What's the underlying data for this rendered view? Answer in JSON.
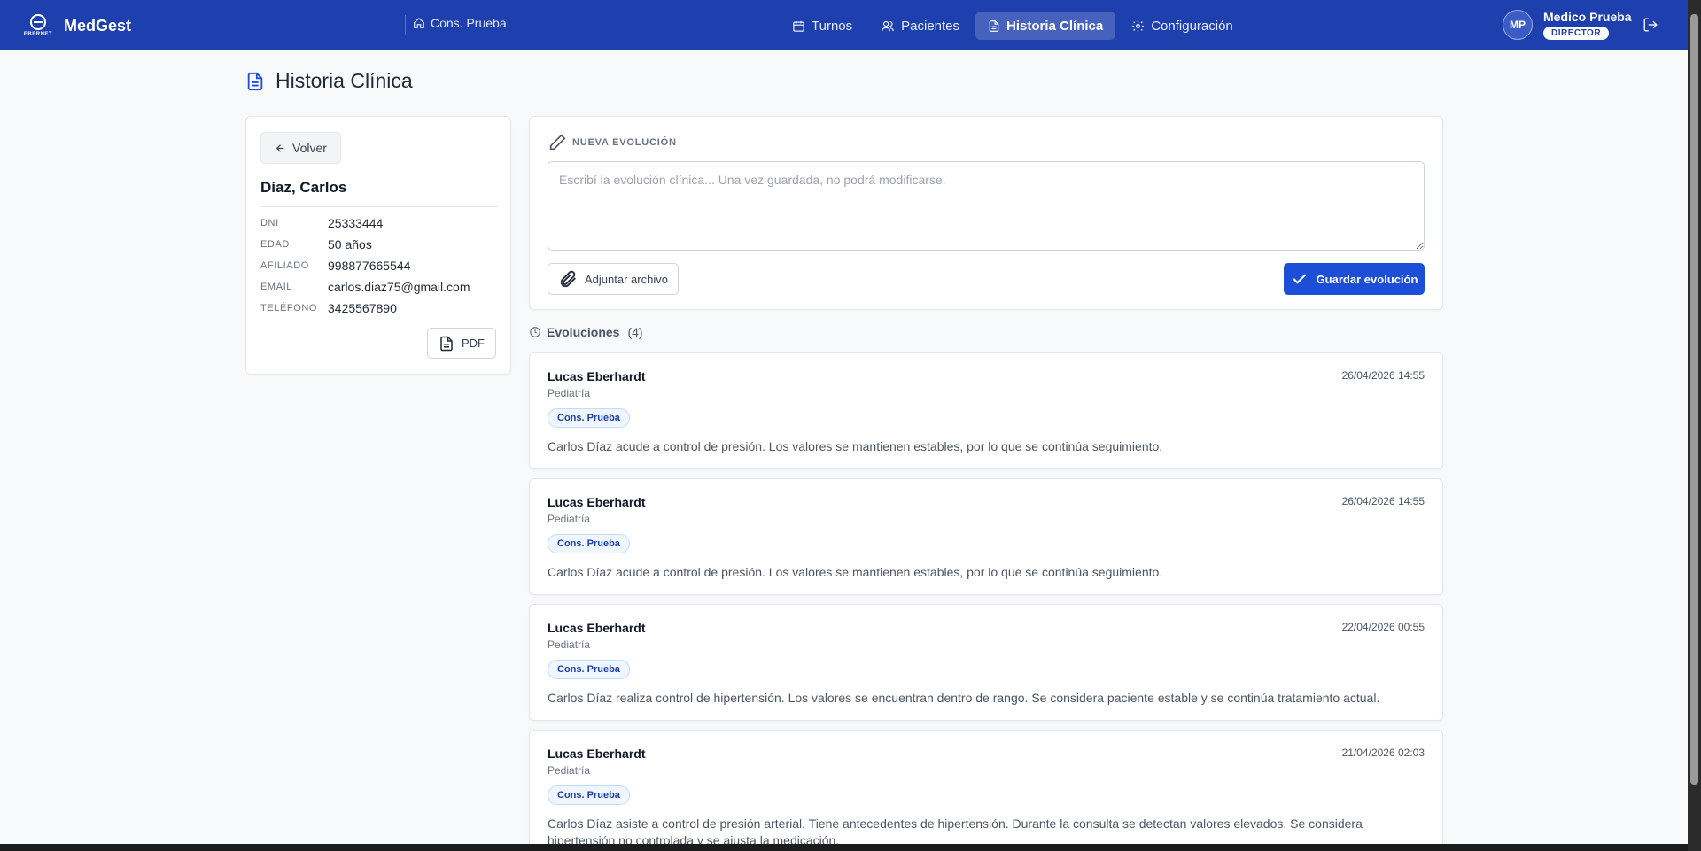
{
  "app": {
    "name": "MedGest",
    "logo_text": "EBERNET",
    "consultorio": "Cons. Prueba"
  },
  "nav": {
    "items": [
      {
        "label": "Turnos",
        "icon": "calendar-icon"
      },
      {
        "label": "Pacientes",
        "icon": "users-icon"
      },
      {
        "label": "Historia Clínica",
        "icon": "file-text-icon",
        "active": true
      },
      {
        "label": "Configuración",
        "icon": "gear-icon"
      }
    ]
  },
  "user": {
    "initials": "MP",
    "name": "Medico Prueba",
    "role": "DIRECTOR"
  },
  "page": {
    "title": "Historia Clínica"
  },
  "patient": {
    "back_label": "Volver",
    "name": "Díaz, Carlos",
    "fields": [
      {
        "label": "DNI",
        "value": "25333444"
      },
      {
        "label": "EDAD",
        "value": "50 años"
      },
      {
        "label": "AFILIADO",
        "value": "998877665544"
      },
      {
        "label": "EMAIL",
        "value": "carlos.diaz75@gmail.com"
      },
      {
        "label": "TELÉFONO",
        "value": "3425567890"
      }
    ],
    "pdf_label": "PDF"
  },
  "new_evolution": {
    "heading": "NUEVA EVOLUCIÓN",
    "placeholder": "Escribí la evolución clínica... Una vez guardada, no podrá modificarse.",
    "attach_label": "Adjuntar archivo",
    "save_label": "Guardar evolución"
  },
  "evolutions": {
    "label": "Evoluciones",
    "count": "(4)",
    "items": [
      {
        "doctor": "Lucas Eberhardt",
        "specialty": "Pediatría",
        "date": "26/04/2026 14:55",
        "badge": "Cons. Prueba",
        "text": "Carlos Díaz acude a control de presión. Los valores se mantienen estables, por lo que se continúa seguimiento."
      },
      {
        "doctor": "Lucas Eberhardt",
        "specialty": "Pediatría",
        "date": "26/04/2026 14:55",
        "badge": "Cons. Prueba",
        "text": "Carlos Díaz acude a control de presión. Los valores se mantienen estables, por lo que se continúa seguimiento."
      },
      {
        "doctor": "Lucas Eberhardt",
        "specialty": "Pediatría",
        "date": "22/04/2026 00:55",
        "badge": "Cons. Prueba",
        "text": "Carlos Díaz realiza control de hipertensión. Los valores se encuentran dentro de rango. Se considera paciente estable y se continúa tratamiento actual."
      },
      {
        "doctor": "Lucas Eberhardt",
        "specialty": "Pediatría",
        "date": "21/04/2026 02:03",
        "badge": "Cons. Prueba",
        "text": "Carlos Díaz asiste a control de presión arterial. Tiene antecedentes de hipertensión. Durante la consulta se detectan valores elevados. Se considera hipertensión no controlada y se ajusta la medicación."
      }
    ]
  },
  "colors": {
    "topbar": "#1e40af",
    "primary_button": "#1d4ed8",
    "background": "#f8f9fb"
  }
}
